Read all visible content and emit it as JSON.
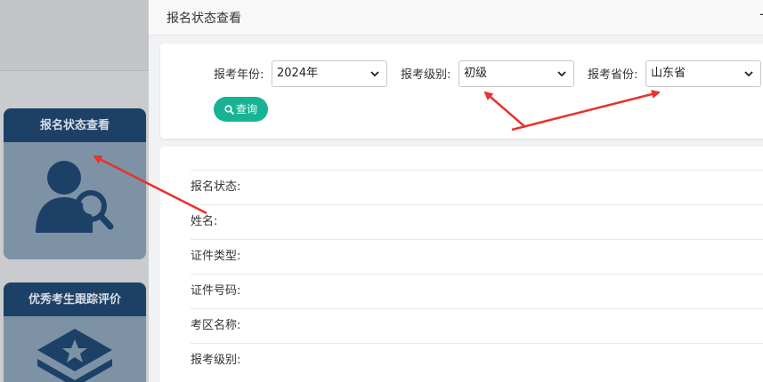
{
  "background": {
    "cards": [
      {
        "title": "报名状态查看",
        "icon": "user-search-icon"
      },
      {
        "title": "优秀考生跟踪评价",
        "icon": "graduation-star-icon"
      }
    ]
  },
  "modal": {
    "title": "报名状态查看",
    "minimize_label": "-"
  },
  "filters": {
    "year": {
      "label": "报考年份:",
      "value": "2024年"
    },
    "level": {
      "label": "报考级别:",
      "value": "初级"
    },
    "province": {
      "label": "报考省份:",
      "value": "山东省"
    },
    "query_label": "查询"
  },
  "details": {
    "rows": [
      {
        "label": "报名状态:"
      },
      {
        "label": "姓名:"
      },
      {
        "label": "证件类型:"
      },
      {
        "label": "证件号码:"
      },
      {
        "label": "考区名称:"
      },
      {
        "label": "报考级别:"
      }
    ]
  },
  "colors": {
    "accent": "#18b394",
    "card_header": "#1d4166",
    "arrow": "#e8322b"
  }
}
